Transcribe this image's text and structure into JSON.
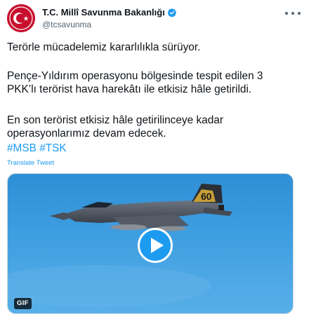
{
  "account": {
    "display_name": "T.C. Millî Savunma Bakanlığı",
    "handle": "@tcsavunma",
    "verified": true,
    "avatar_icon": "crescent-star-emblem-icon"
  },
  "tweet": {
    "line1": "Terörle mücadelemiz kararlılıkla sürüyor.",
    "line2": "Pençe-Yıldırım operasyonu bölgesinde tespit edilen 3 PKK’lı terörist hava harekâtı ile etkisiz hâle getirildi.",
    "line3": "En son terörist etkisiz hâle getirilinceye kadar operasyonlarımız devam edecek.",
    "hashtags": [
      "#MSB",
      "#TSK"
    ],
    "translate_label": "Translate Tweet"
  },
  "media": {
    "type_badge": "GIF",
    "play_icon": "play-icon",
    "tail_text": "60"
  },
  "colors": {
    "link": "#1d9bf0",
    "text": "#0f1419",
    "secondary": "#536471",
    "avatar_bg": "#c8102e",
    "sky": "#3d9de0"
  }
}
